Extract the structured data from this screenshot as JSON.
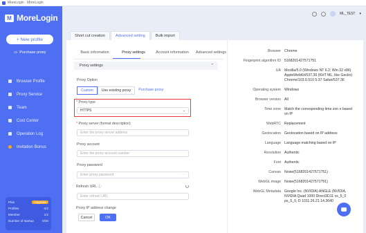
{
  "window": {
    "title": "MoreLogin · MoreLogin"
  },
  "brand": {
    "name": "MoreLogin",
    "logo_letter": "M"
  },
  "sidebar": {
    "new_profile": "+ New profile",
    "purchase_proxy": "Purchase proxy",
    "items": [
      {
        "label": "Browser Profile"
      },
      {
        "label": "Proxy Service"
      },
      {
        "label": "Team"
      },
      {
        "label": "Cost Center"
      },
      {
        "label": "Operation Log"
      },
      {
        "label": "Invitation Bonus"
      }
    ],
    "plan": {
      "plan_label": "Plan",
      "upgrade": "Upgrade",
      "rows": [
        {
          "k": "Profiles",
          "v": "0/2"
        },
        {
          "k": "Member",
          "v": "1/2"
        },
        {
          "k": "Number of startup",
          "v": "0/20"
        }
      ]
    }
  },
  "header": {
    "user": "ML_TEST"
  },
  "outer_tabs": [
    "Short cut creation",
    "Advanced setting",
    "Bulk import"
  ],
  "inner_tabs": [
    "Basic information",
    "Proxy settings",
    "Account information",
    "Advanced settings"
  ],
  "proxy": {
    "section_title": "Proxy settings",
    "option_label": "Proxy Option",
    "options": [
      "Custom",
      "Use existing proxy",
      "Purchase proxy"
    ],
    "type_label": "Proxy type",
    "type_value": "HTTPS",
    "server_label": "Proxy server (format description)",
    "server_placeholder": "Enter the proxy server address",
    "account_label": "Proxy account",
    "account_placeholder": "Enter the proxy account number",
    "password_label": "Proxy password",
    "password_placeholder": "Enter proxy password",
    "refresh_label": "Refresh URL",
    "refresh_placeholder": "Enter refresh URL",
    "ip_change_label": "Proxy IP address change",
    "cancel": "Cancel",
    "ok": "OK"
  },
  "summary": [
    {
      "k": "Browser",
      "v": "Chrome"
    },
    {
      "k": "Fingerprint algorithm ID",
      "v": "5168201427571?51"
    },
    {
      "k": "UA",
      "v": "Mozilla/5.0 (Windows NT 6.2; Win 32 x86) AppleWebKit/537.36 (KHT ML, like Gecko) Chrome/103.0.510 5.37 Safari/537.36"
    },
    {
      "k": "Operating system",
      "v": "Windows"
    },
    {
      "k": "Browser version",
      "v": "All"
    },
    {
      "k": "Time zone",
      "v": "Match the corresponding time zon e based on IP"
    },
    {
      "k": "WebRTC",
      "v": "Replacement"
    },
    {
      "k": "Geolocation",
      "v": "Geolocation based on IP address"
    },
    {
      "k": "Language",
      "v": "Language matching based on IP"
    },
    {
      "k": "Resolution",
      "v": "Authentic"
    },
    {
      "k": "Font",
      "v": "Authentic"
    },
    {
      "k": "Canvas",
      "v": "Noise(5168201427571?51)"
    },
    {
      "k": "WebGL image",
      "v": "Noise(5168201427571?51)"
    },
    {
      "k": "WebGL Metadata",
      "v": "Google Inc. (NVIDIA) ANGLE (NVIDIA, NVIDIA Quad 1000 Direct3D11 vs_5_0 ps_5_0, D 1011.26.21.14.3640"
    }
  ]
}
